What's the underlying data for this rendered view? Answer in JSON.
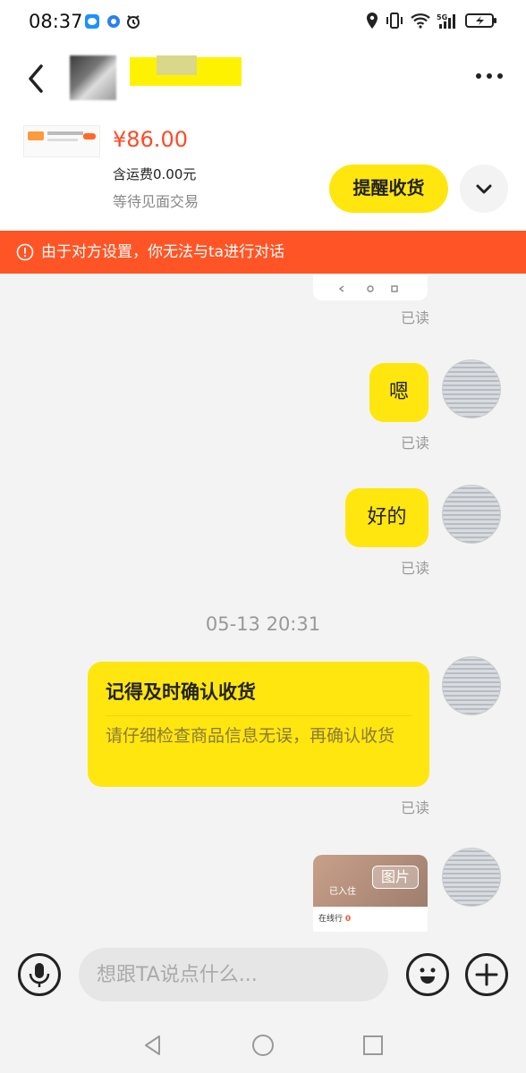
{
  "status_bar": {
    "time": "08:37"
  },
  "product": {
    "price": "¥86.00",
    "shipping": "含运费0.00元",
    "trade_status": "等待见面交易",
    "remind_button": "提醒收货"
  },
  "banner": {
    "text": "由于对方设置，你无法与ta进行对话"
  },
  "messages": {
    "read_label": "已读",
    "msg1": "嗯",
    "msg2": "好的",
    "timestamp": "05-13 20:31",
    "card_title": "记得及时确认收货",
    "card_body": "请仔细检查商品信息无误，再确认收货",
    "image_tag": "图片",
    "image_sub": "已入住",
    "image_row_label": "在线行",
    "image_row_value": "0"
  },
  "input": {
    "placeholder": "想跟TA说点什么..."
  },
  "colors": {
    "accent_yellow": "#ffe60f",
    "price_red": "#ff4a26",
    "banner_orange": "#ff5526"
  }
}
